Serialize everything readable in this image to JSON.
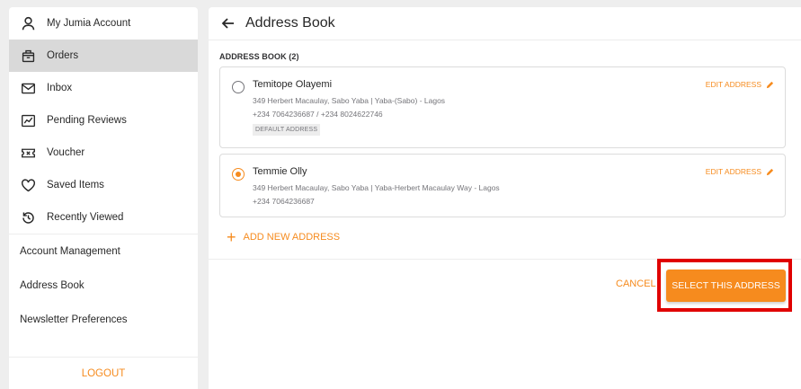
{
  "sidebar": {
    "items": [
      {
        "label": "My Jumia Account",
        "icon": "user-icon"
      },
      {
        "label": "Orders",
        "icon": "orders-icon"
      },
      {
        "label": "Inbox",
        "icon": "mail-icon"
      },
      {
        "label": "Pending Reviews",
        "icon": "review-icon"
      },
      {
        "label": "Voucher",
        "icon": "voucher-icon"
      },
      {
        "label": "Saved Items",
        "icon": "heart-icon"
      },
      {
        "label": "Recently Viewed",
        "icon": "history-icon"
      }
    ],
    "links": [
      "Account Management",
      "Address Book",
      "Newsletter Preferences"
    ],
    "logout": "LOGOUT"
  },
  "main": {
    "title": "Address Book",
    "section_label": "ADDRESS BOOK (2)",
    "addresses": [
      {
        "name": "Temitope Olayemi",
        "address": "349 Herbert Macaulay, Sabo Yaba | Yaba-(Sabo) - Lagos",
        "phone": "+234 7064236687 / +234 8024622746",
        "badge": "DEFAULT ADDRESS",
        "edit_label": "EDIT ADDRESS",
        "selected": false
      },
      {
        "name": "Temmie Olly",
        "address": "349 Herbert Macaulay, Sabo Yaba | Yaba-Herbert Macaulay Way - Lagos",
        "phone": "+234 7064236687",
        "edit_label": "EDIT ADDRESS",
        "selected": true
      }
    ],
    "add_new_label": "ADD NEW ADDRESS",
    "add_new_symbol": "+",
    "cancel_label": "CANCEL",
    "select_label": "SELECT THIS ADDRESS"
  },
  "colors": {
    "accent": "#f68b1e",
    "highlight": "#e00000",
    "active_nav_bg": "#d9d9d9"
  }
}
